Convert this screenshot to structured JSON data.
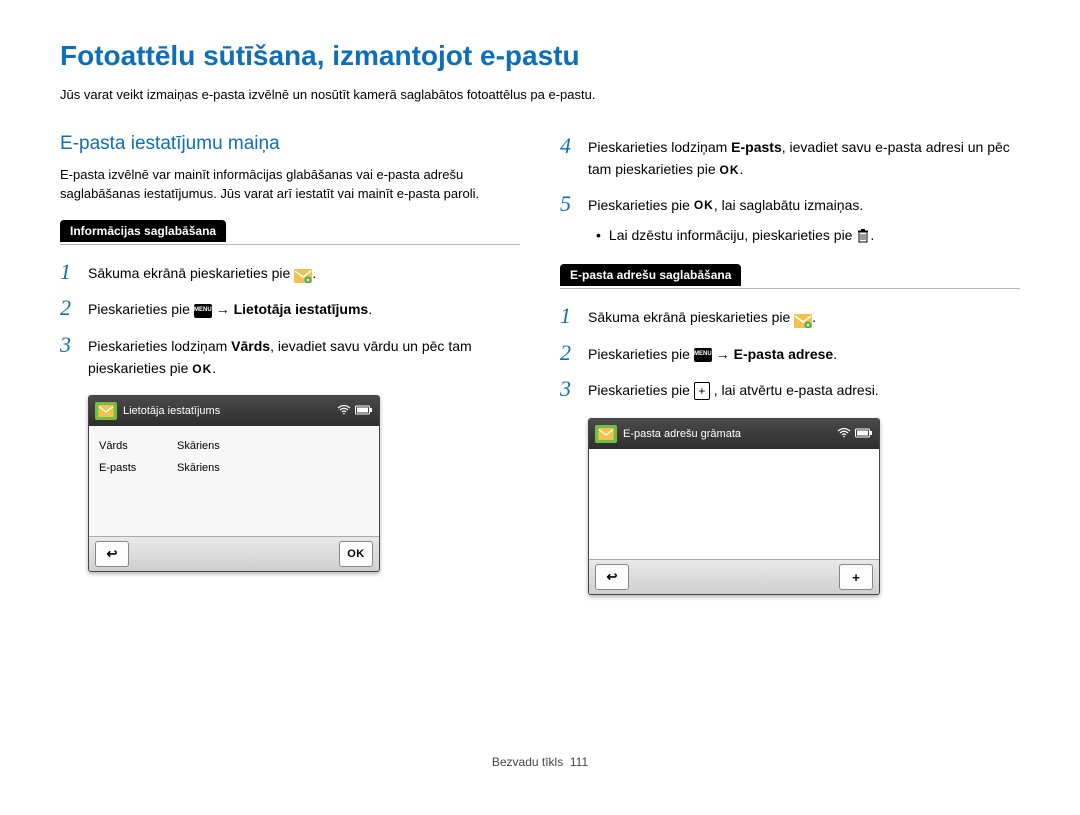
{
  "page_title": "Fotoattēlu sūtīšana, izmantojot e-pastu",
  "intro": "Jūs varat veikt izmaiņas e-pasta izvēlnē un nosūtīt kamerā saglabātos fotoattēlus pa e-pastu.",
  "left": {
    "section_title": "E-pasta iestatījumu maiņa",
    "section_text": "E-pasta izvēlnē var mainīt informācijas glabāšanas vai e-pasta adrešu saglabāšanas iestatījumus. Jūs varat arī iestatīt vai mainīt e-pasta paroli.",
    "tab": "Informācijas saglabāšana",
    "steps": {
      "s1": "Sākuma ekrānā pieskarieties pie",
      "s2_a": "Pieskarieties pie",
      "s2_b": "Lietotāja iestatījums",
      "s3_a": "Pieskarieties lodziņam ",
      "s3_bold": "Vārds",
      "s3_b": ", ievadiet savu vārdu un pēc tam pieskarieties pie "
    },
    "mock": {
      "title": "Lietotāja iestatījums",
      "row1_label": "Vārds",
      "row1_value": "Skāriens",
      "row2_label": "E-pasts",
      "row2_value": "Skāriens",
      "back": "↩",
      "ok": "OK"
    }
  },
  "right": {
    "s4_a": "Pieskarieties lodziņam ",
    "s4_bold": "E-pasts",
    "s4_b": ", ievadiet savu e-pasta adresi un pēc tam pieskarieties pie ",
    "s5_a": "Pieskarieties pie ",
    "s5_b": ", lai saglabātu izmaiņas.",
    "s5_bullet": "Lai dzēstu informāciju, pieskarieties pie ",
    "tab": "E-pasta adrešu saglabāšana",
    "steps2": {
      "s1": "Sākuma ekrānā pieskarieties pie",
      "s2_a": "Pieskarieties pie",
      "s2_b": "E-pasta adrese",
      "s3_a": "Pieskarieties pie ",
      "s3_b": ", lai atvērtu e-pasta adresi."
    },
    "mock": {
      "title": "E-pasta adrešu grāmata",
      "back": "↩",
      "plus": "+"
    }
  },
  "footer": {
    "section": "Bezvadu tīkls",
    "page": "111"
  },
  "icons": {
    "menu": "MENU"
  }
}
